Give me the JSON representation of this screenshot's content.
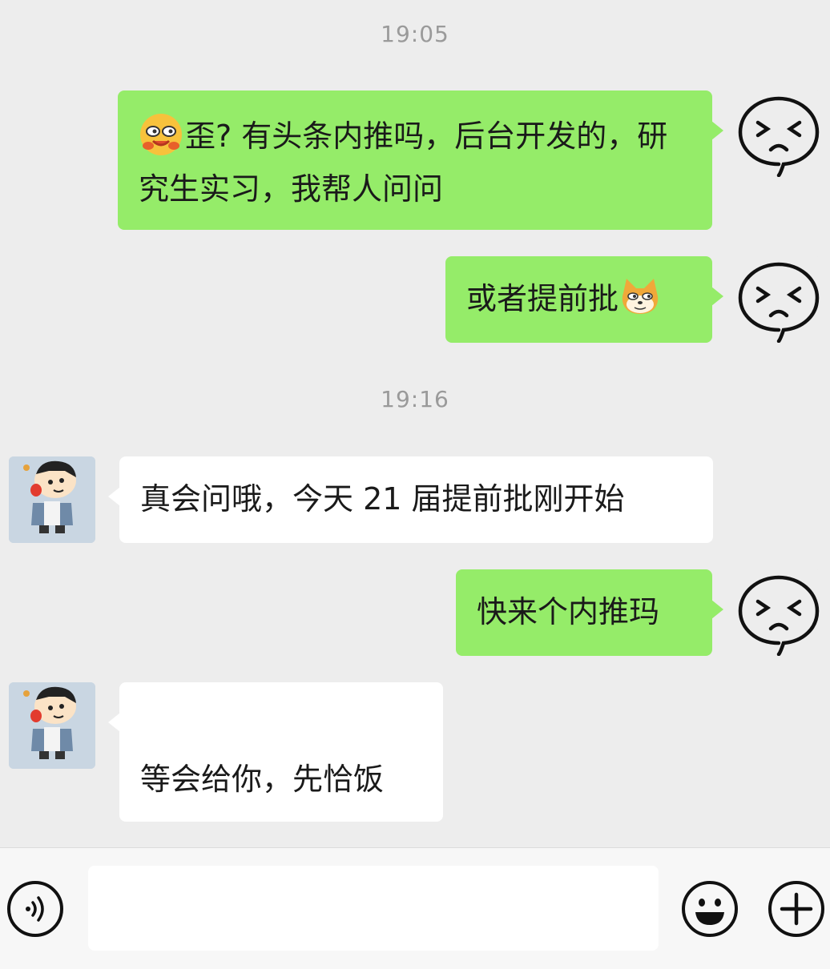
{
  "messages": [
    {
      "type": "time",
      "text": "19:05"
    },
    {
      "type": "text",
      "from": "me",
      "text": "歪? 有头条内推吗，后台开发的，研究生实习，我帮人问问",
      "emoji_prefix": "grinning-with-hands-emoji"
    },
    {
      "type": "text",
      "from": "me",
      "text": "或者提前批",
      "emoji_suffix": "doge-emoji"
    },
    {
      "type": "time",
      "text": "19:16"
    },
    {
      "type": "text",
      "from": "peer",
      "text": "真会问哦，今天 21 届提前批刚开始"
    },
    {
      "type": "text",
      "from": "me",
      "text": "快来个内推玛"
    },
    {
      "type": "text",
      "from": "peer",
      "text": "等会给你，先恰饭"
    }
  ],
  "avatars": {
    "me": "squinting-face-avatar",
    "peer": "crayon-shinchan-avatar"
  },
  "input_bar": {
    "value": "",
    "icons": [
      "voice-icon",
      "emoji-icon",
      "plus-icon"
    ]
  },
  "colors": {
    "background": "#ededed",
    "my_bubble": "#95ec69",
    "peer_bubble": "#ffffff",
    "timestamp": "#9a9a9a"
  }
}
